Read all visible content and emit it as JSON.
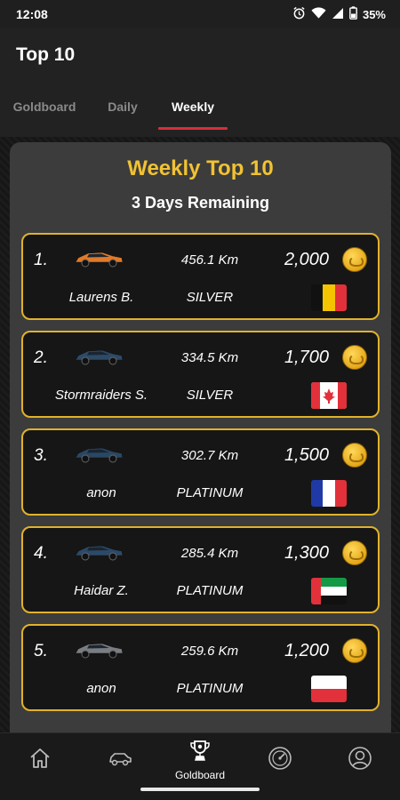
{
  "status": {
    "time": "12:08",
    "battery": "35%",
    "icons": [
      "alarm-icon",
      "wifi-icon",
      "signal-icon",
      "battery-icon"
    ]
  },
  "header": {
    "title": "Top 10"
  },
  "tabs": [
    {
      "label": "Goldboard",
      "active": false
    },
    {
      "label": "Daily",
      "active": false
    },
    {
      "label": "Weekly",
      "active": true
    }
  ],
  "panel": {
    "title": "Weekly Top 10",
    "subtitle": "3 Days Remaining"
  },
  "entries": [
    {
      "rank": "1.",
      "car_color": "#e07a2a",
      "distance": "456.1 Km",
      "points": "2,000",
      "name": "Laurens B.",
      "tier": "SILVER",
      "flag": "belgium"
    },
    {
      "rank": "2.",
      "car_color": "#2d4a66",
      "distance": "334.5 Km",
      "points": "1,700",
      "name": "Stormraiders S.",
      "tier": "SILVER",
      "flag": "canada"
    },
    {
      "rank": "3.",
      "car_color": "#2a4763",
      "distance": "302.7 Km",
      "points": "1,500",
      "name": "anon",
      "tier": "PLATINUM",
      "flag": "france"
    },
    {
      "rank": "4.",
      "car_color": "#2c4a68",
      "distance": "285.4 Km",
      "points": "1,300",
      "name": "Haidar Z.",
      "tier": "PLATINUM",
      "flag": "uae"
    },
    {
      "rank": "5.",
      "car_color": "#7a7d82",
      "distance": "259.6 Km",
      "points": "1,200",
      "name": "anon",
      "tier": "PLATINUM",
      "flag": "poland"
    }
  ],
  "nav": [
    {
      "icon": "home-icon",
      "label": ""
    },
    {
      "icon": "car-icon",
      "label": ""
    },
    {
      "icon": "trophy-icon",
      "label": "Goldboard",
      "active": true
    },
    {
      "icon": "speedometer-icon",
      "label": ""
    },
    {
      "icon": "profile-icon",
      "label": ""
    }
  ],
  "colors": {
    "accent_gold": "#f1c232",
    "card_border": "#e0b22c",
    "tab_indicator": "#d62e3a"
  }
}
